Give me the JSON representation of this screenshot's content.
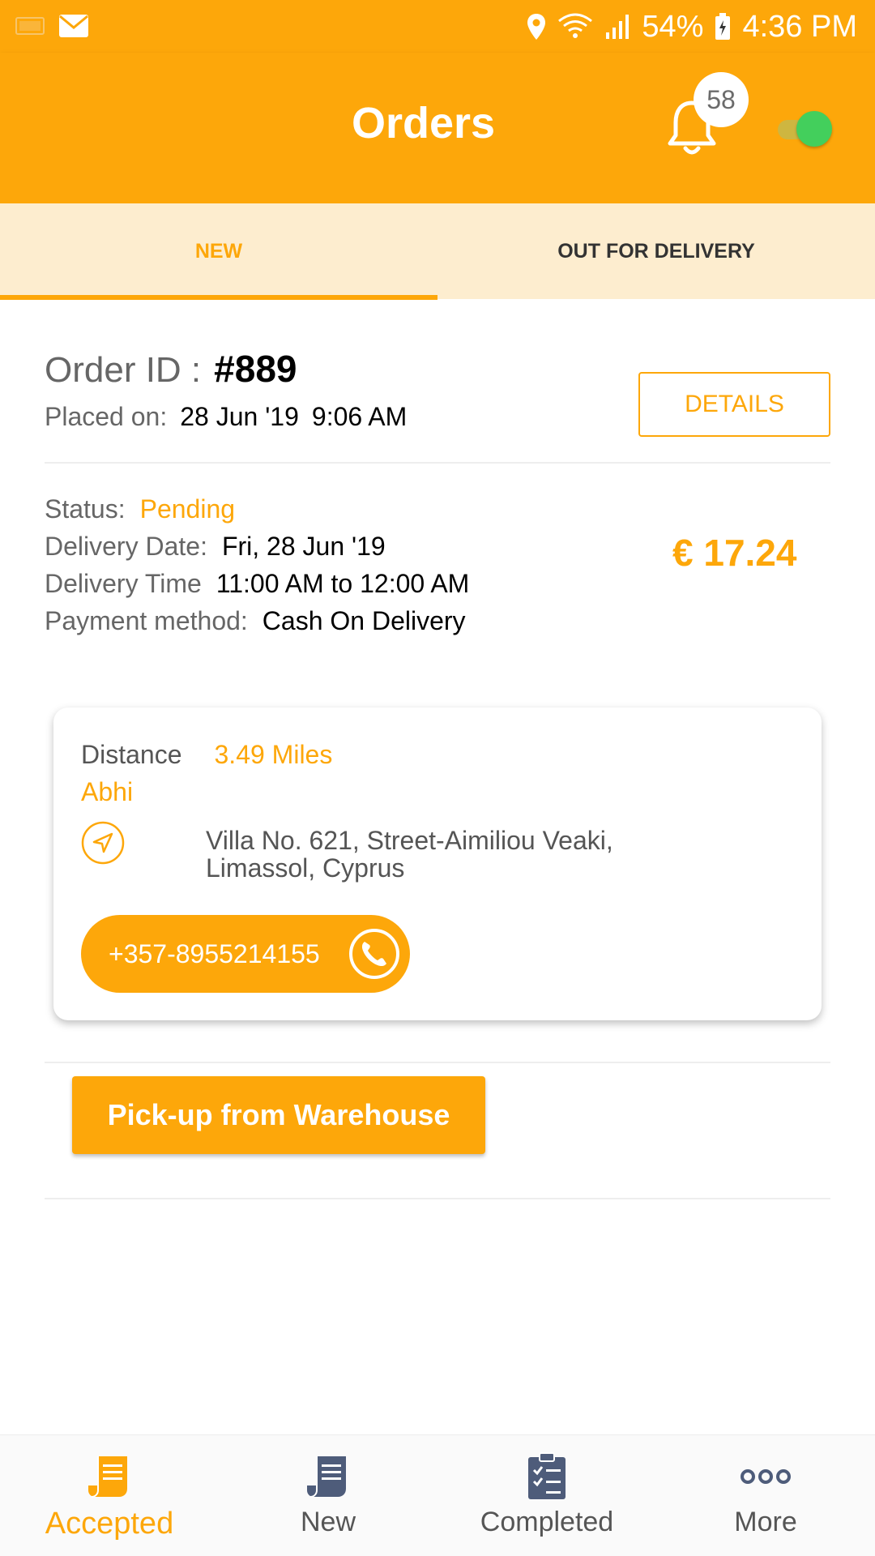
{
  "status_bar": {
    "battery": "54%",
    "time": "4:36 PM"
  },
  "app_bar": {
    "title": "Orders",
    "notification_count": "58"
  },
  "tabs": [
    {
      "label": "NEW",
      "active": true
    },
    {
      "label": "OUT FOR DELIVERY",
      "active": false
    }
  ],
  "order": {
    "id_label": "Order ID :",
    "id_value": "#889",
    "placed_label": "Placed on:",
    "placed_date": "28 Jun '19",
    "placed_time": "9:06 AM",
    "details_label": "DETAILS",
    "status_label": "Status:",
    "status_value": "Pending",
    "delivery_date_label": "Delivery Date:",
    "delivery_date_value": "Fri, 28 Jun '19",
    "delivery_time_label": "Delivery Time",
    "delivery_time_value": "11:00 AM to 12:00 AM",
    "payment_label": "Payment method:",
    "payment_value": "Cash On Delivery",
    "price": "€ 17.24"
  },
  "customer": {
    "distance_label": "Distance",
    "distance_value": "3.49 Miles",
    "name": "Abhi",
    "address": "Villa No. 621, Street-Aimiliou Veaki, Limassol, Cyprus",
    "phone": "+357-8955214155"
  },
  "pickup_label": "Pick-up from Warehouse",
  "bottom_nav": [
    {
      "label": "Accepted",
      "icon": "receipt-icon",
      "active": true
    },
    {
      "label": "New",
      "icon": "receipt-icon",
      "active": false
    },
    {
      "label": "Completed",
      "icon": "clipboard-check-icon",
      "active": false
    },
    {
      "label": "More",
      "icon": "more-dots-icon",
      "active": false
    }
  ],
  "colors": {
    "brand": "#FDA70A",
    "tab_bg": "#FDEDCF",
    "online": "#43CF5C"
  }
}
